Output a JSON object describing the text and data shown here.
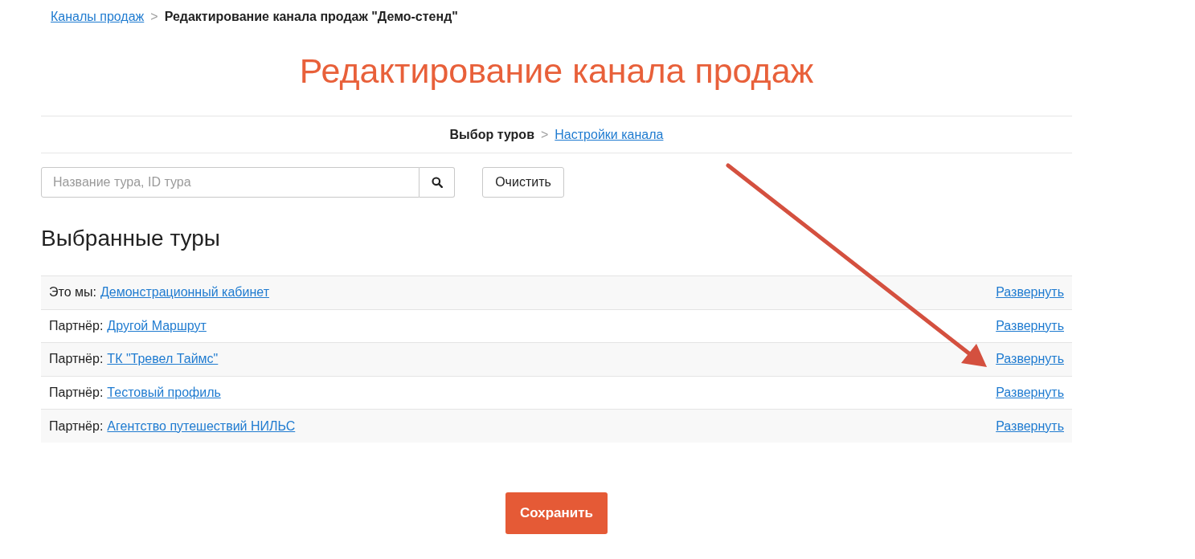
{
  "breadcrumb": {
    "link": "Каналы продаж",
    "separator": ">",
    "current": "Редактирование канала продаж \"Демо-стенд\""
  },
  "title": "Редактирование канала продаж",
  "steps": [
    {
      "label": "Выбор туров",
      "selected": true
    },
    {
      "label": "Настройки канала",
      "selected": false
    }
  ],
  "step_separator": ">",
  "search": {
    "placeholder": "Название тура, ID тура"
  },
  "clear_button": "Очистить",
  "section_title": "Выбранные туры",
  "rows": [
    {
      "label": "Это мы:",
      "name": "Демонстрационный кабинет",
      "action": "Развернуть"
    },
    {
      "label": "Партнёр:",
      "name": "Другой Маршрут",
      "action": "Развернуть"
    },
    {
      "label": "Партнёр:",
      "name": "ТК \"Тревел Таймс\"",
      "action": "Развернуть"
    },
    {
      "label": "Партнёр:",
      "name": "Тестовый профиль",
      "action": "Развернуть"
    },
    {
      "label": "Партнёр:",
      "name": "Агентство путешествий НИЛЬС",
      "action": "Развернуть"
    }
  ],
  "save_button": "Сохранить"
}
